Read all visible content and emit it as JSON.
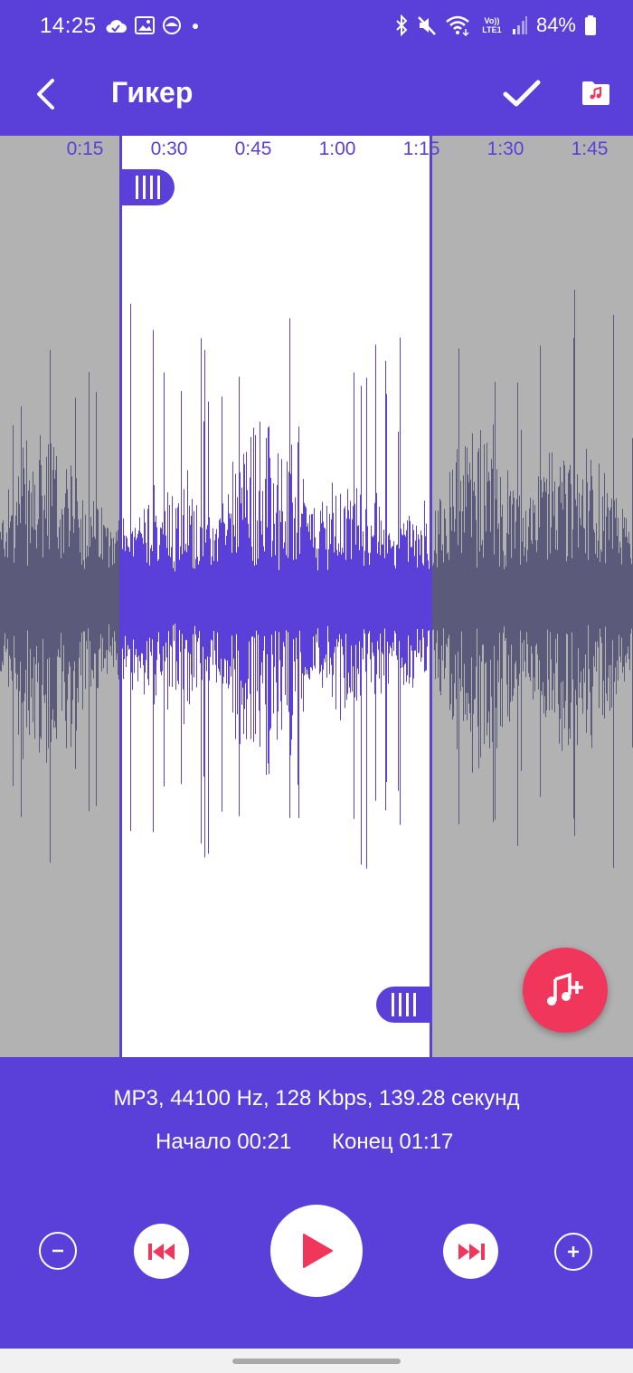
{
  "status_bar": {
    "time": "14:25",
    "battery_text": "84%",
    "network_label": "Vo)) LTE1",
    "left_icons": [
      "cloud-icon",
      "image-icon",
      "app-icon",
      "dot-icon"
    ],
    "right_icons": [
      "bluetooth-icon",
      "mute-icon",
      "wifi-icon",
      "signal-icon",
      "battery-icon"
    ]
  },
  "app_bar": {
    "title": "Гикер",
    "back_icon": "back-arrow-icon",
    "confirm_icon": "check-icon",
    "folder_icon": "music-folder-icon"
  },
  "timeline": {
    "ticks": [
      "0:15",
      "0:30",
      "0:45",
      "1:00",
      "1:15",
      "1:30",
      "1:45"
    ]
  },
  "selection": {
    "start": "00:21",
    "end": "01:17"
  },
  "fab": {
    "icon": "add-music-icon"
  },
  "file_info": {
    "text": "MP3, 44100 Hz, 128 Kbps, 139.28 секунд"
  },
  "range": {
    "start_label": "Начало 00:21",
    "end_label": "Конец 01:17"
  },
  "controls": {
    "zoom_out_icon": "minus-icon",
    "skip_back_icon": "skip-back-icon",
    "play_icon": "play-icon",
    "skip_forward_icon": "skip-forward-icon",
    "zoom_in_icon": "plus-icon"
  },
  "colors": {
    "primary": "#5a3fd9",
    "accent": "#f1365c",
    "waveform_selected": "#5a3fd9",
    "waveform_unselected": "#5c5a7a",
    "unselected_bg": "#b2b2b2",
    "selected_bg": "#ffffff"
  }
}
